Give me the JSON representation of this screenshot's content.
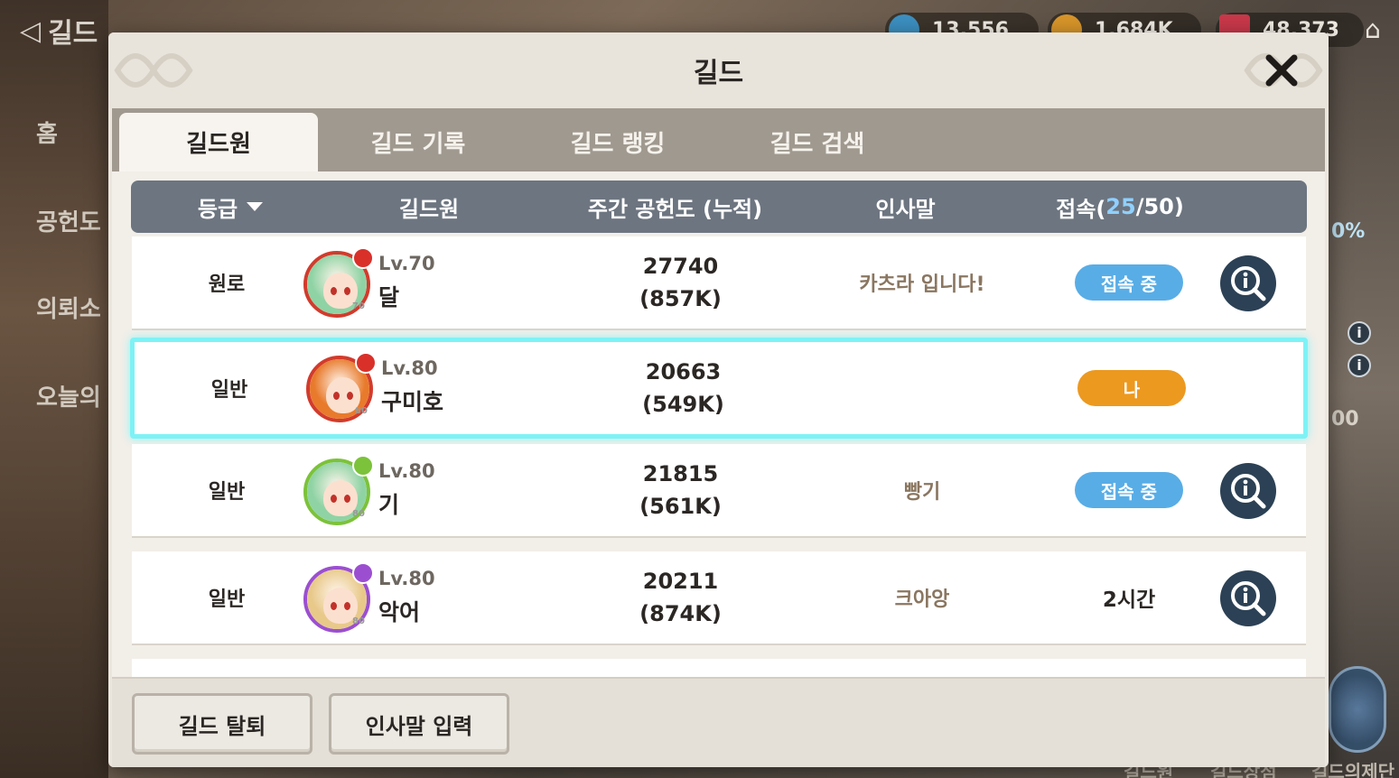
{
  "background": {
    "title": "길드",
    "menu": [
      "홈",
      "공헌도",
      "의뢰소",
      "오늘의"
    ],
    "currencies": [
      {
        "value": "13,556",
        "color": "#3c8fc0"
      },
      {
        "value": "1,684K",
        "color": "#d7952a"
      },
      {
        "value": "48,373",
        "color": "#c8384a"
      }
    ],
    "side_percent": "0%",
    "side_num": "00",
    "bottom_tabs": [
      "길드원",
      "길드상점",
      "길드의제단"
    ]
  },
  "dialog": {
    "title": "길드",
    "tabs": [
      {
        "label": "길드원",
        "active": true
      },
      {
        "label": "길드 기록",
        "active": false
      },
      {
        "label": "길드 랭킹",
        "active": false
      },
      {
        "label": "길드 검색",
        "active": false
      }
    ],
    "table_header": {
      "rank": "등급",
      "member": "길드원",
      "contribution": "주간 공헌도 (누적)",
      "greeting": "인사말",
      "online_prefix": "접속(",
      "online_count": "25",
      "online_suffix": "/50)"
    },
    "members": [
      {
        "rank": "원로",
        "level": "Lv.70",
        "name": "달",
        "contribution": "27740",
        "cumulative": "(857K)",
        "greeting": "카츠라 입니다!",
        "status": "접속 중",
        "status_type": "online",
        "avatar_hair": "#8fd3a4",
        "badge_color": "#d9302a",
        "badge_lv": "70",
        "ring": "#d23b2c"
      },
      {
        "rank": "일반",
        "level": "Lv.80",
        "name": "구미호",
        "contribution": "20663",
        "cumulative": "(549K)",
        "greeting": "",
        "status": "나",
        "status_type": "me",
        "avatar_hair": "#e87a2c",
        "badge_color": "#d9302a",
        "badge_lv": "80",
        "ring": "#d23b2c"
      },
      {
        "rank": "일반",
        "level": "Lv.80",
        "name": "기",
        "contribution": "21815",
        "cumulative": "(561K)",
        "greeting": "빵기",
        "status": "접속 중",
        "status_type": "online",
        "avatar_hair": "#8fd3a4",
        "badge_color": "#7cc23a",
        "badge_lv": "80",
        "ring": "#7cc23a"
      },
      {
        "rank": "일반",
        "level": "Lv.80",
        "name": "악어",
        "contribution": "20211",
        "cumulative": "(874K)",
        "greeting": "크아앙",
        "status": "2시간",
        "status_type": "offline",
        "avatar_hair": "#e8c98a",
        "badge_color": "#9b4fd0",
        "badge_lv": "80",
        "ring": "#9b4fd0"
      }
    ],
    "footer": {
      "leave_button": "길드 탈퇴",
      "greeting_button": "인사말 입력"
    }
  }
}
